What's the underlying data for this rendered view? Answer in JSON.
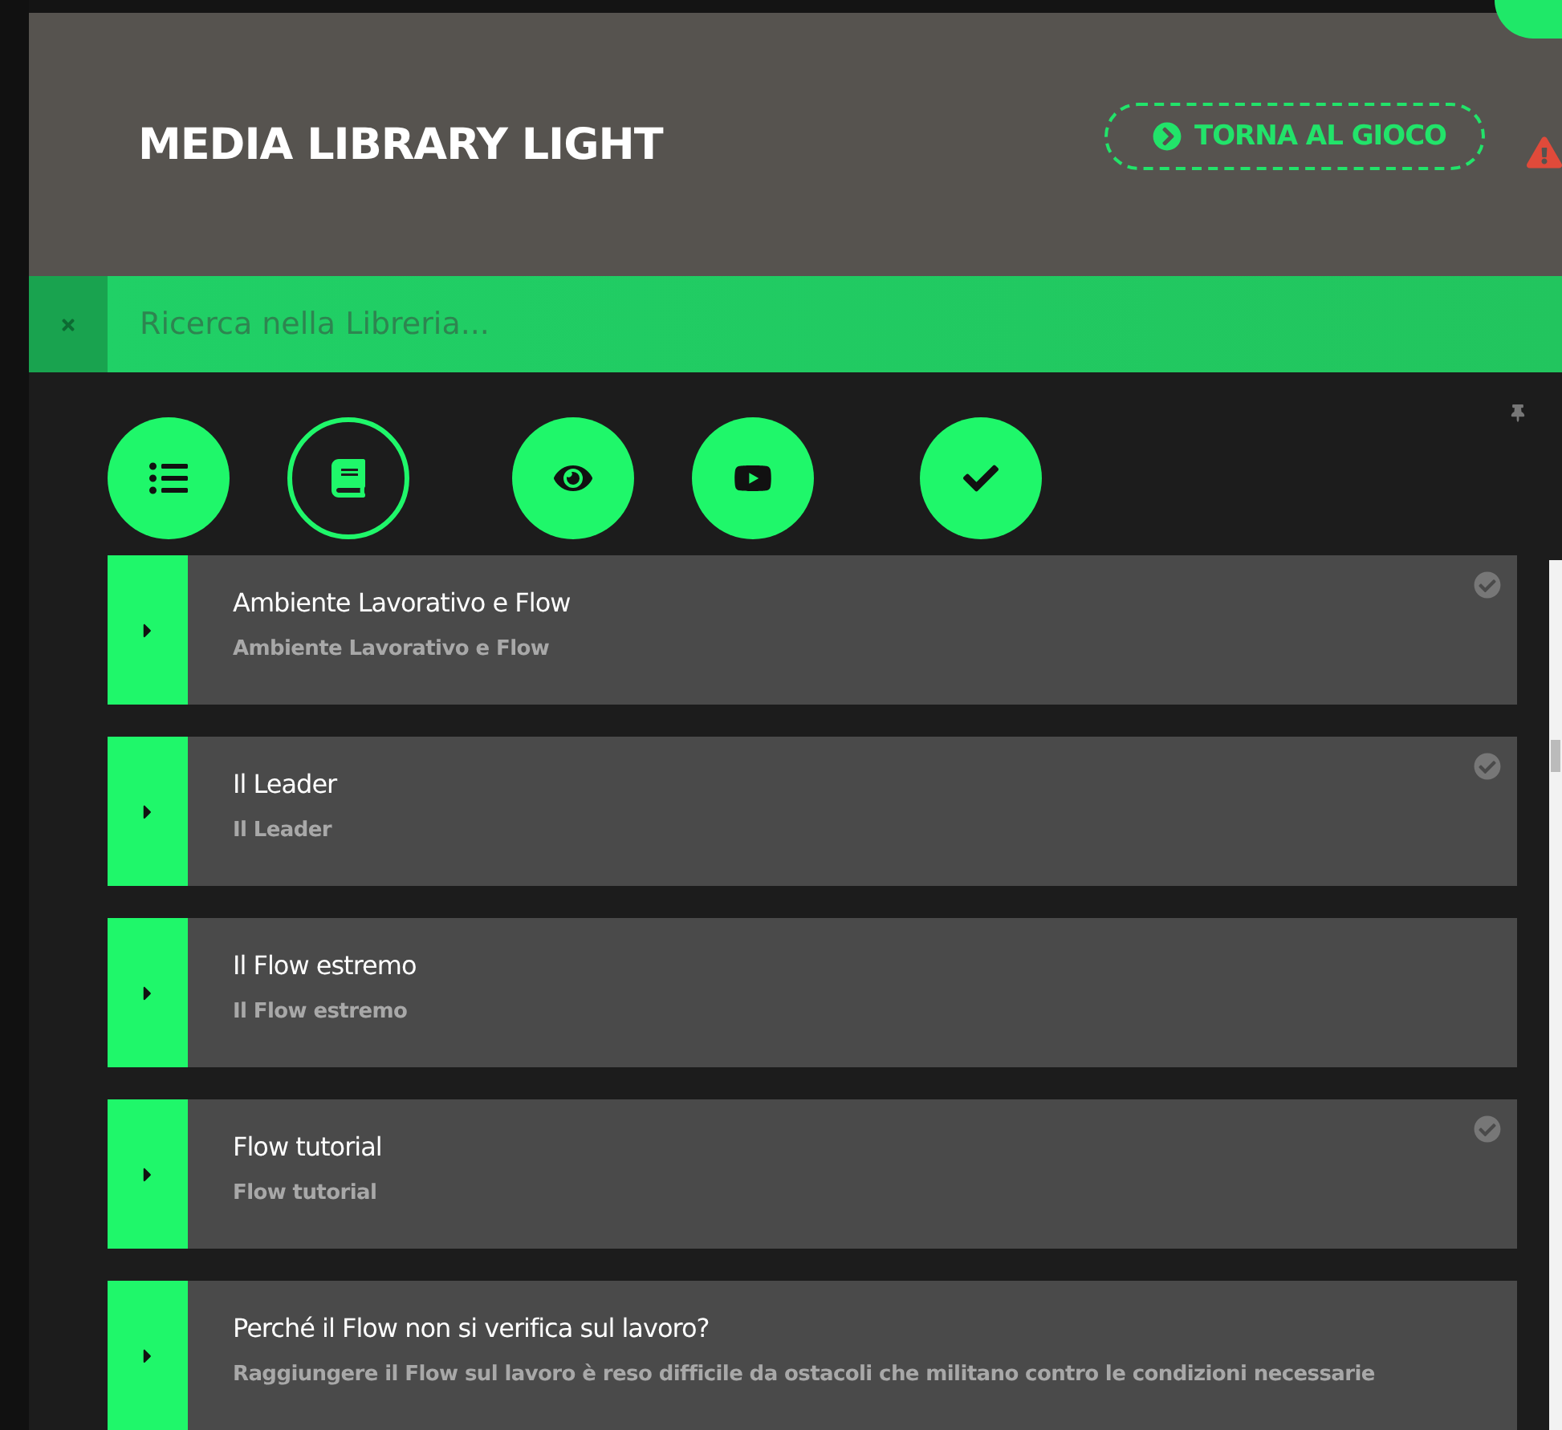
{
  "header": {
    "title": "MEDIA LIBRARY LIGHT",
    "back_button": "TORNA AL GIOCO"
  },
  "search": {
    "placeholder": "Ricerca nella Libreria..."
  },
  "filters": [
    {
      "kind": "list",
      "selected": false
    },
    {
      "kind": "book",
      "selected": true
    },
    {
      "kind": "eye",
      "selected": false
    },
    {
      "kind": "video",
      "selected": false
    },
    {
      "kind": "check",
      "selected": false
    }
  ],
  "items": [
    {
      "title": "Ambiente Lavorativo e Flow",
      "subtitle": "Ambiente Lavorativo e Flow",
      "completed": true
    },
    {
      "title": "Il Leader",
      "subtitle": "Il Leader",
      "completed": true
    },
    {
      "title": "Il Flow estremo",
      "subtitle": "Il Flow estremo",
      "completed": false
    },
    {
      "title": "Flow tutorial",
      "subtitle": "Flow tutorial",
      "completed": true
    },
    {
      "title": "Perché il Flow non si verifica sul lavoro?",
      "subtitle": "Raggiungere il Flow sul lavoro è reso difficile da ostacoli che militano contro le condizioni necessarie",
      "completed": false
    }
  ]
}
